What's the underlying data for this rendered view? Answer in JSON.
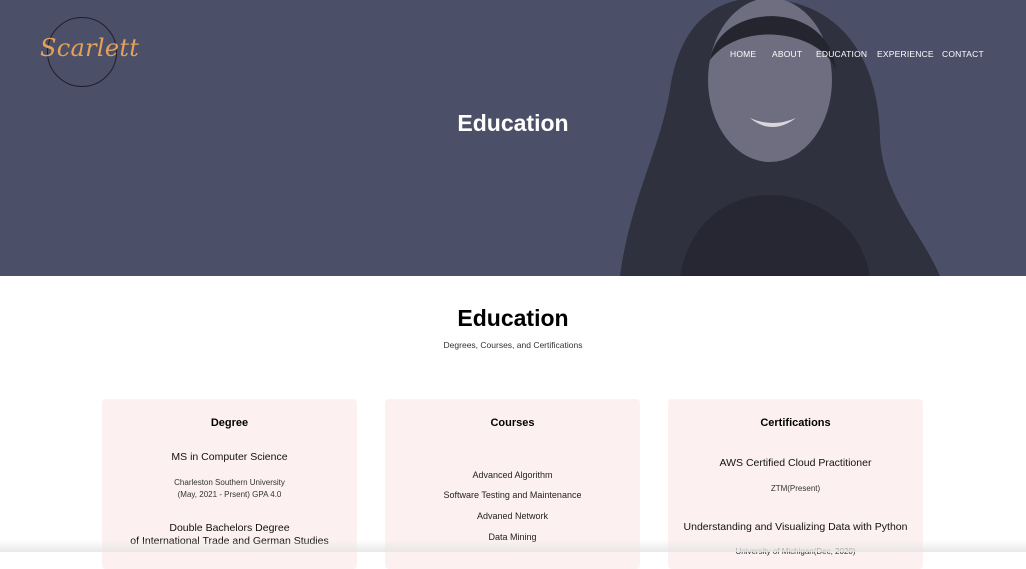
{
  "brand": {
    "logo_text": "Scarlett"
  },
  "nav": {
    "items": [
      "HOME",
      "ABOUT",
      "EDUCATION",
      "EXPERIENCE",
      "CONTACT"
    ]
  },
  "hero": {
    "title": "Education"
  },
  "section": {
    "title": "Education",
    "subtitle": "Degrees, Courses, and Certifications"
  },
  "cards": {
    "degree": {
      "title": "Degree",
      "entries": [
        {
          "name": "MS in Computer Science",
          "school": "Charleston Southern University",
          "detail": "(May, 2021 - Prsent) GPA 4.0"
        },
        {
          "name_line1": "Double Bachelors Degree",
          "name_line2": "of International Trade and German Studies"
        }
      ]
    },
    "courses": {
      "title": "Courses",
      "items": [
        "Advanced Algorithm",
        "Software Testing and Maintenance",
        "Advaned Network",
        "Data Mining"
      ]
    },
    "certifications": {
      "title": "Certifications",
      "entries": [
        {
          "name": "AWS Certified Cloud Practitioner",
          "detail": "ZTM(Present)"
        },
        {
          "name": "Understanding and Visualizing Data with Python",
          "detail": "University of Michigan(Dec, 2020)"
        }
      ]
    }
  },
  "colors": {
    "hero_bg": "#4b5068",
    "accent": "#e5a05a",
    "card_bg": "#fcf1f0"
  }
}
